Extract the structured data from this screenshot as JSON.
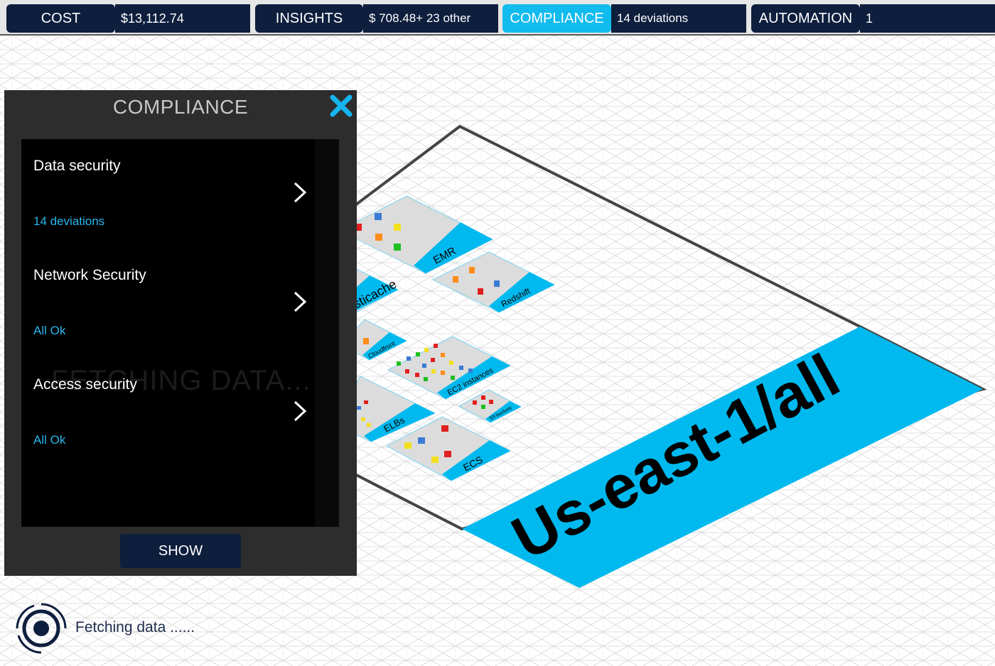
{
  "topbar": {
    "cost": {
      "label": "COST",
      "value": "$13,112.74"
    },
    "insights": {
      "label": "INSIGHTS",
      "value": "$ 708.48+ 23 other"
    },
    "compliance": {
      "label": "COMPLIANCE",
      "value": "14 deviations"
    },
    "automation": {
      "label": "AUTOMATION",
      "value": "1"
    }
  },
  "scene": {
    "region_label": "Us-east-1/all",
    "services": [
      {
        "label": "EMR"
      },
      {
        "label": "Redshift"
      },
      {
        "label": "Elasticache"
      },
      {
        "label": "Cloudfront"
      },
      {
        "label": "EC2 instances"
      },
      {
        "label": "S3 buckets"
      },
      {
        "label": "ELBs"
      },
      {
        "label": "ECS"
      }
    ]
  },
  "panel": {
    "title": "COMPLIANCE",
    "items": [
      {
        "title": "Data security",
        "status": "14 deviations"
      },
      {
        "title": "Network Security",
        "status": "All Ok"
      },
      {
        "title": "Access security",
        "status": "All Ok"
      }
    ],
    "background_text": "FETCHING DATA...",
    "show_label": "SHOW"
  },
  "loader": {
    "text": "Fetching data ......"
  },
  "colors": {
    "accent": "#11bbee",
    "navy": "#0e1e3d",
    "status_blue": "#29b6ef",
    "panel": "#2d2d2d"
  }
}
